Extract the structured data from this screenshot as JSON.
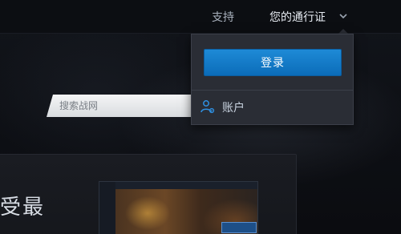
{
  "header": {
    "support_label": "支持",
    "passport_label": "您的通行证"
  },
  "search": {
    "placeholder": "搜索战网"
  },
  "dropdown": {
    "login_label": "登录",
    "account_label": "账户"
  },
  "hero": {
    "headline": "受最"
  },
  "colors": {
    "login_button": "#1079c8",
    "dropdown_bg": "#2a2d35"
  },
  "icons": {
    "passport_toggle": "chevron-down-icon",
    "account": "account-gear-icon"
  }
}
